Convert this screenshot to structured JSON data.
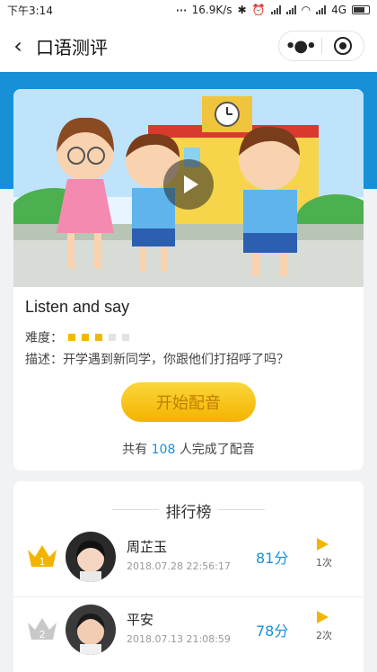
{
  "status_bar": {
    "time": "下午3:14",
    "speed": "16.9K/s",
    "network": "4G"
  },
  "nav": {
    "back_icon": "chevron-left-icon",
    "title": "口语测评",
    "more_icon": "more-dots-icon",
    "close_icon": "target-icon"
  },
  "theme": {
    "accent": "#1890d8",
    "gold": "#f3b400"
  },
  "lesson": {
    "title": "Listen and say",
    "difficulty_label": "难度：",
    "difficulty_level": 3,
    "difficulty_max": 5,
    "desc_label": "描述：",
    "description": "开学遇到新同学，你跟他们打招呼了吗？",
    "start_button": "开始配音",
    "count_prefix": "共有",
    "count": "108",
    "count_suffix": "人完成了配音"
  },
  "ranking": {
    "title": "排行榜",
    "entries": [
      {
        "rank": "1",
        "name": "周芷玉",
        "time": "2018.07.28  22:56:17",
        "score": "81分",
        "plays": "1次",
        "crown": "gold-crown-icon"
      },
      {
        "rank": "2",
        "name": "平安",
        "time": "2018.07.13  21:08:59",
        "score": "78分",
        "plays": "2次",
        "crown": "silver-crown-icon"
      }
    ]
  }
}
